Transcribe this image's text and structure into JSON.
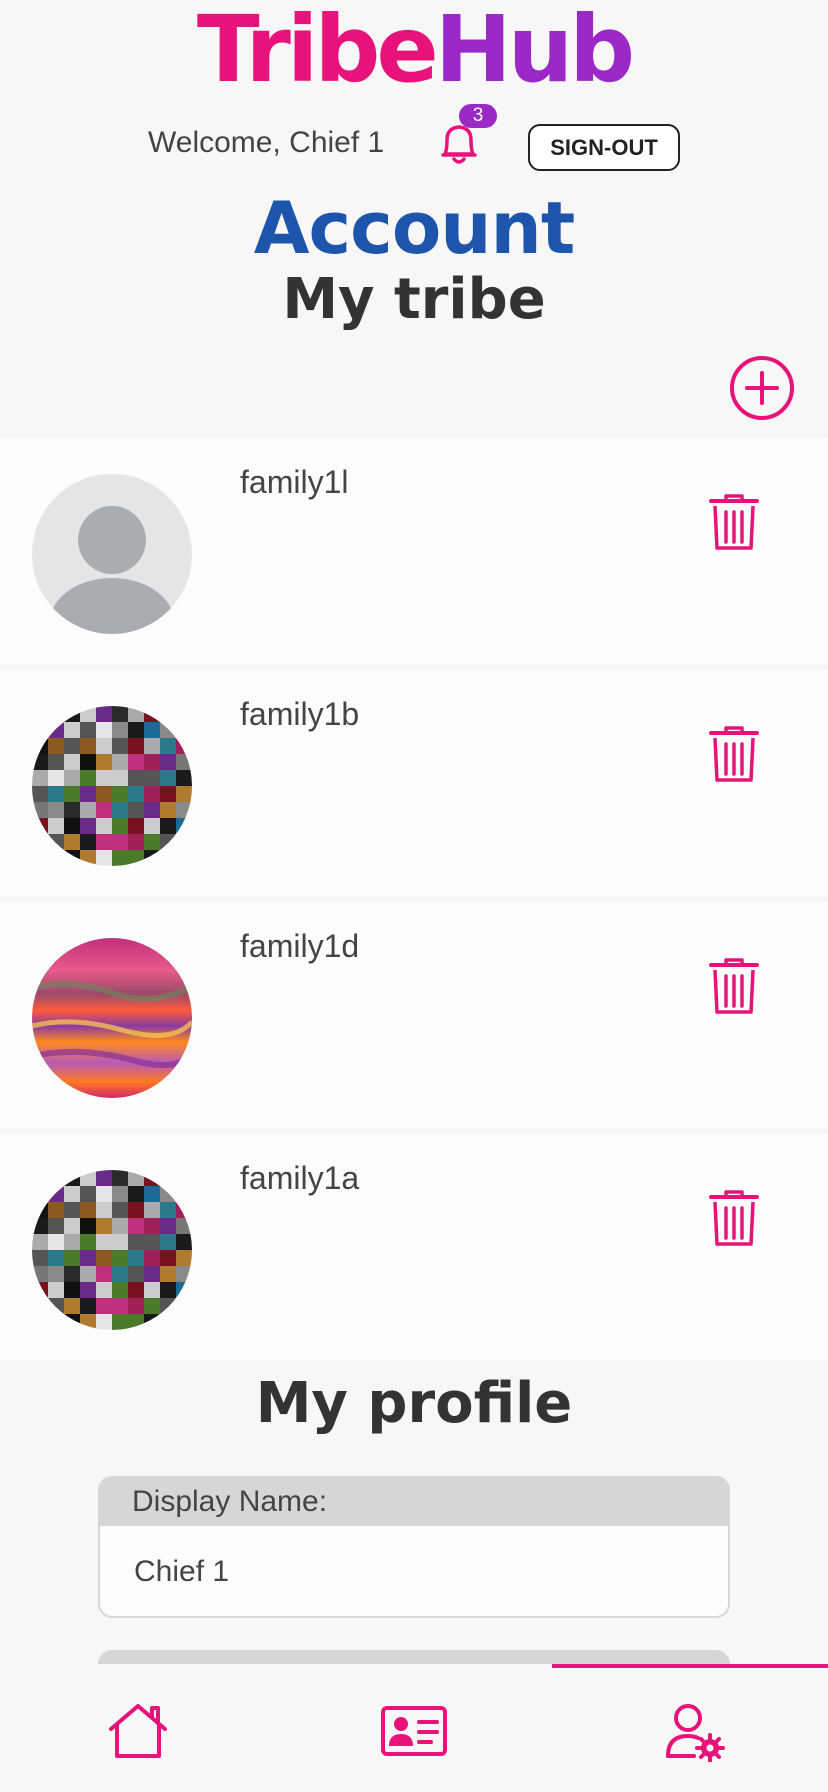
{
  "app": {
    "logo_part1": "Tribe",
    "logo_part2": "Hub"
  },
  "header": {
    "welcome_text": "Welcome, Chief 1",
    "notification_count": "3",
    "signout_label": "SIGN-OUT"
  },
  "page": {
    "title": "Account"
  },
  "tribe": {
    "title": "My tribe",
    "members": [
      {
        "name": "family1l",
        "avatar": "default-avatar"
      },
      {
        "name": "family1b",
        "avatar": "pixel-mosaic"
      },
      {
        "name": "family1d",
        "avatar": "sunset-swirl"
      },
      {
        "name": "family1a",
        "avatar": "pixel-mosaic"
      }
    ]
  },
  "profile": {
    "title": "My profile",
    "display_name_label": "Display Name:",
    "display_name_value": "Chief 1"
  },
  "nav": {
    "items": [
      {
        "icon": "home-icon",
        "active": false
      },
      {
        "icon": "contact-card-icon",
        "active": false
      },
      {
        "icon": "user-settings-icon",
        "active": true
      }
    ]
  },
  "colors": {
    "brand_pink": "#e8137a",
    "brand_purple": "#9b29c7",
    "title_blue": "#1d55ad"
  }
}
